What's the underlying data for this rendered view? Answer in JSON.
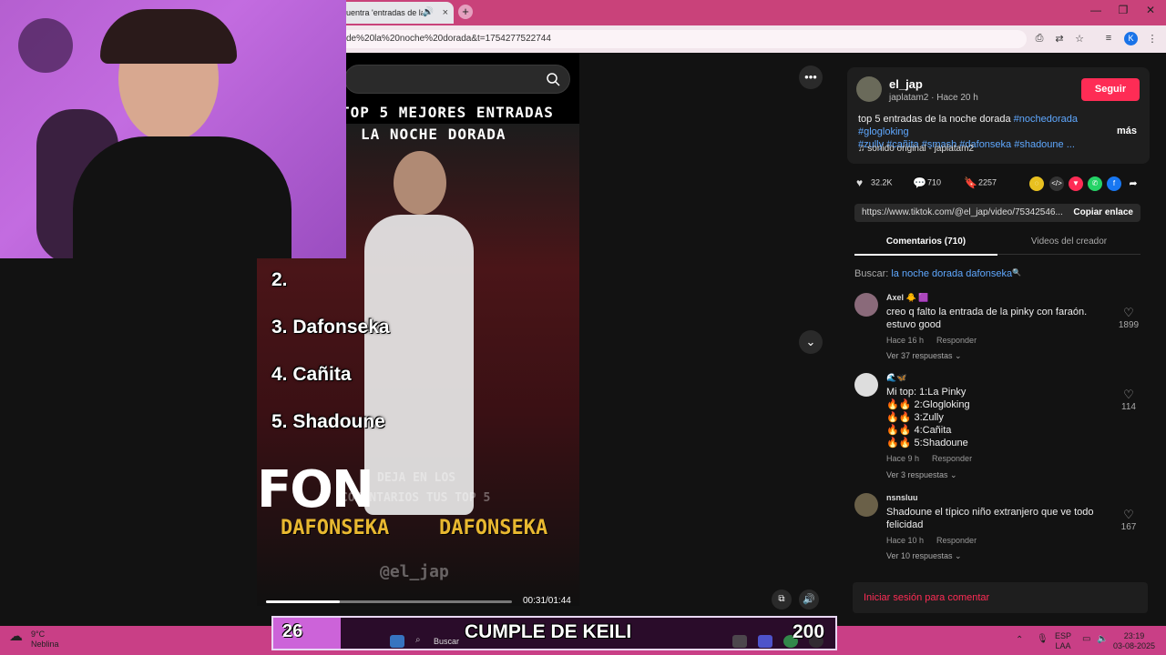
{
  "browser": {
    "tab_title": "uentra 'entradas de la n",
    "tab_close": "×",
    "new_tab": "+",
    "url": "de%20la%20noche%20dorada&t=1754277522744",
    "profile_initial": "K",
    "window_min": "—",
    "window_max": "❐",
    "window_close": "✕"
  },
  "video": {
    "overlay_line1": "TOP 5 MEJORES ENTRADAS",
    "overlay_line2": "LA NOCHE DORADA",
    "ranks": [
      "2.",
      "3. Dafonseka",
      "4. Cañita",
      "5. Shadoune"
    ],
    "big_text": "FON",
    "yellow_left": "DAFONSEKA",
    "yellow_right": "DAFONSEKA",
    "ghost_line1": "DEJA EN LOS",
    "ghost_line2": "COMENTARIOS TUS TOP 5",
    "watermark": "@el_jap",
    "time": "00:31/01:44",
    "progress": 0.3
  },
  "creator": {
    "username": "el_jap",
    "subline": "japlatam2 · Hace 20 h",
    "follow_label": "Seguir",
    "desc_plain": "top 5 entradas de la noche dorada ",
    "desc_tags_line1": "#nochedorada #glogloking",
    "desc_tags_line2": "#zully #cañita #smash #dafonseka #shadoune ...",
    "more_label": "más",
    "sound": "sonido original - japlatam2"
  },
  "stats": {
    "likes": "32.2K",
    "comments": "710",
    "saves": "2257"
  },
  "share": {
    "link": "https://www.tiktok.com/@el_jap/video/75342546...",
    "copy_label": "Copiar enlace"
  },
  "tabs": {
    "comments": "Comentarios (710)",
    "creator_videos": "Videos del creador"
  },
  "search": {
    "prefix": "Buscar: ",
    "query": "la noche dorada dafonseka"
  },
  "comments": [
    {
      "name": "Axel 🐥 🟪",
      "text": "creo q falto la entrada de la pinky con faraón.\nestuvo good",
      "time": "Hace 16 h",
      "reply": "Responder",
      "replies": "Ver 37 respuestas ⌄",
      "likes": "1899"
    },
    {
      "name": "🌊🦋",
      "text": "Mi top: 1:La Pinky\n🔥🔥 2:Glogloking\n🔥🔥 3:Zully\n🔥🔥 4:Cañita\n🔥🔥 5:Shadoune",
      "time": "Hace 9 h",
      "reply": "Responder",
      "replies": "Ver 3 respuestas ⌄",
      "likes": "114"
    },
    {
      "name": "nsnsluu",
      "text": "Shadoune el típico niño extranjero que ve todo\nfelicidad",
      "time": "Hace 10 h",
      "reply": "Responder",
      "replies": "Ver 10 respuestas ⌄",
      "likes": "167"
    }
  ],
  "login_prompt": "Iniciar sesión para comentar",
  "taskbar": {
    "temp": "9°C",
    "condition": "Neblina",
    "search": "Buscar",
    "lang1": "ESP",
    "lang2": "LAA",
    "clock_time": "23:19",
    "clock_date": "03-08-2025"
  },
  "banner": {
    "left_number": "26",
    "title": "CUMPLE DE KEILI",
    "right_number": "200"
  },
  "colors": {
    "accent": "#fe2c55",
    "link": "#5fa8ff",
    "taskbar": "#c93f86",
    "banner_left": "#cc63d9"
  }
}
